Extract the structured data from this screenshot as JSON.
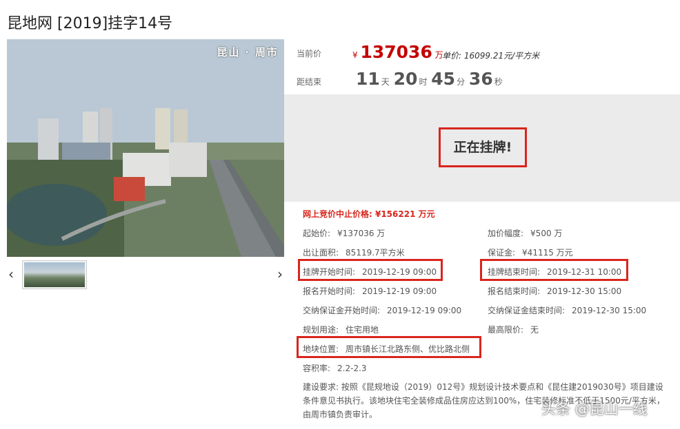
{
  "page_title": "昆地网 [2019]挂字14号",
  "photo": {
    "caption": "昆山 · 周市"
  },
  "nav": {
    "prev_icon": "‹",
    "next_icon": "›"
  },
  "price": {
    "current_label": "当前价",
    "currency": "¥",
    "amount": "137036",
    "amount_unit": "万",
    "unit_price_label": "单价: ",
    "unit_price": "16099.21元/平方米"
  },
  "countdown": {
    "label": "距结束",
    "days": "11",
    "days_unit": "天",
    "hours": "20",
    "hours_unit": "时",
    "minutes": "45",
    "minutes_unit": "分",
    "seconds": "36",
    "seconds_unit": "秒"
  },
  "status": "正在挂牌!",
  "stop_price": "网上竞价中止价格:  ¥156221 万元",
  "details": {
    "start_price": {
      "label": "起始价:",
      "value": "¥137036 万"
    },
    "increment": {
      "label": "加价幅度:",
      "value": "¥500 万"
    },
    "area": {
      "label": "出让面积:",
      "value": "85119.7平方米"
    },
    "deposit": {
      "label": "保证金:",
      "value": "¥41115 万元"
    },
    "listing_start": {
      "label": "挂牌开始时间:",
      "value": "2019-12-19 09:00"
    },
    "listing_end": {
      "label": "挂牌结束时间:",
      "value": "2019-12-31 10:00"
    },
    "reg_start": {
      "label": "报名开始时间:",
      "value": "2019-12-19 09:00"
    },
    "reg_end": {
      "label": "报名结束时间:",
      "value": "2019-12-30 15:00"
    },
    "deposit_start": {
      "label": "交纳保证金开始时间:",
      "value": "2019-12-19 09:00"
    },
    "deposit_end": {
      "label": "交纳保证金结束时间:",
      "value": "2019-12-30 15:00"
    },
    "usage": {
      "label": "规划用途:",
      "value": "住宅用地"
    },
    "max_price": {
      "label": "最高限价:",
      "value": "无"
    },
    "location": {
      "label": "地块位置:",
      "value": "周市镇长江北路东侧、优比路北侧"
    },
    "far": {
      "label": "容积率:",
      "value": "2.2-2.3"
    }
  },
  "requirements": "建设要求:  按照《昆规地设（2019）012号》规划设计技术要点和《昆住建2019030号》项目建设条件意见书执行。该地块住宅全装修成品住房应达到100%，住宅装修标准不低于1500元/平方米，由周市镇负责审计。",
  "watermark": "头条 @昆山一线",
  "colors": {
    "accent": "#d9251d",
    "price": "#c40000",
    "status_bg": "#ebebeb"
  }
}
